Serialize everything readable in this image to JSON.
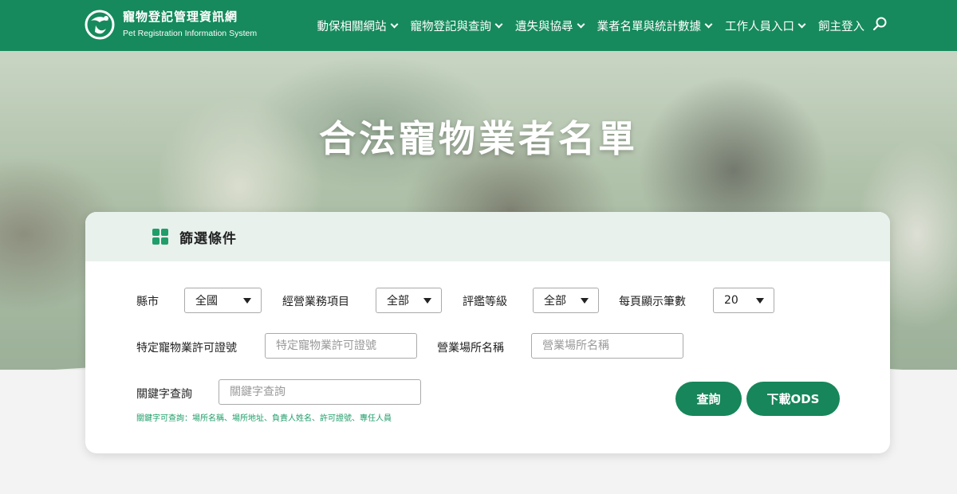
{
  "brand": {
    "title_zh": "寵物登記管理資訊網",
    "title_en": "Pet Registration Information System"
  },
  "nav": {
    "items": [
      "動保相關網站",
      "寵物登記與查詢",
      "遺失與協尋",
      "業者名單與統計數據",
      "工作人員入口",
      "飼主登入"
    ]
  },
  "hero": {
    "title": "合法寵物業者名單"
  },
  "filter": {
    "title": "篩選條件",
    "county_label": "縣市",
    "county_value": "全國",
    "business_label": "經營業務項目",
    "business_value": "全部",
    "rating_label": "評鑑等級",
    "rating_value": "全部",
    "per_page_label": "每頁顯示筆數",
    "per_page_value": "20",
    "license_label": "特定寵物業許可證號",
    "license_placeholder": "特定寵物業許可證號",
    "venue_label": "營業場所名稱",
    "venue_placeholder": "營業場所名稱",
    "keyword_label": "關鍵字查詢",
    "keyword_placeholder": "關鍵字查詢",
    "keyword_hint": "關鍵字可查詢：場所名稱、場所地址、負責人姓名、許可證號、專任人員",
    "search_button": "查詢",
    "download_button": "下載ODS"
  },
  "colors": {
    "primary": "#168a5c",
    "accent": "#1f9e6a",
    "card_header": "#e9f1ed"
  }
}
